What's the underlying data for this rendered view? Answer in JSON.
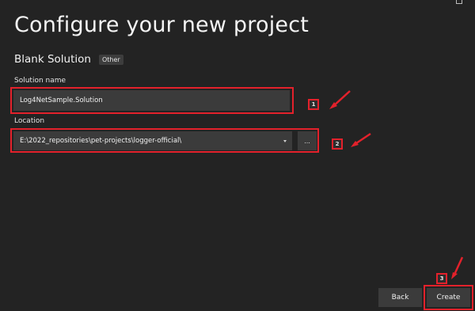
{
  "header": {
    "title": "Configure your new project",
    "template_name": "Blank Solution",
    "template_tag": "Other"
  },
  "form": {
    "solution_name": {
      "label": "Solution name",
      "value": "Log4NetSample.Solution"
    },
    "location": {
      "label": "Location",
      "value": "E:\\2022_repositories\\pet-projects\\logger-official\\",
      "browse_label": "..."
    }
  },
  "footer": {
    "back_label": "Back",
    "create_label": "Create"
  },
  "annotations": {
    "color": "#e3212b",
    "badge_solution_name": "1",
    "badge_location": "2",
    "badge_create": "3"
  }
}
